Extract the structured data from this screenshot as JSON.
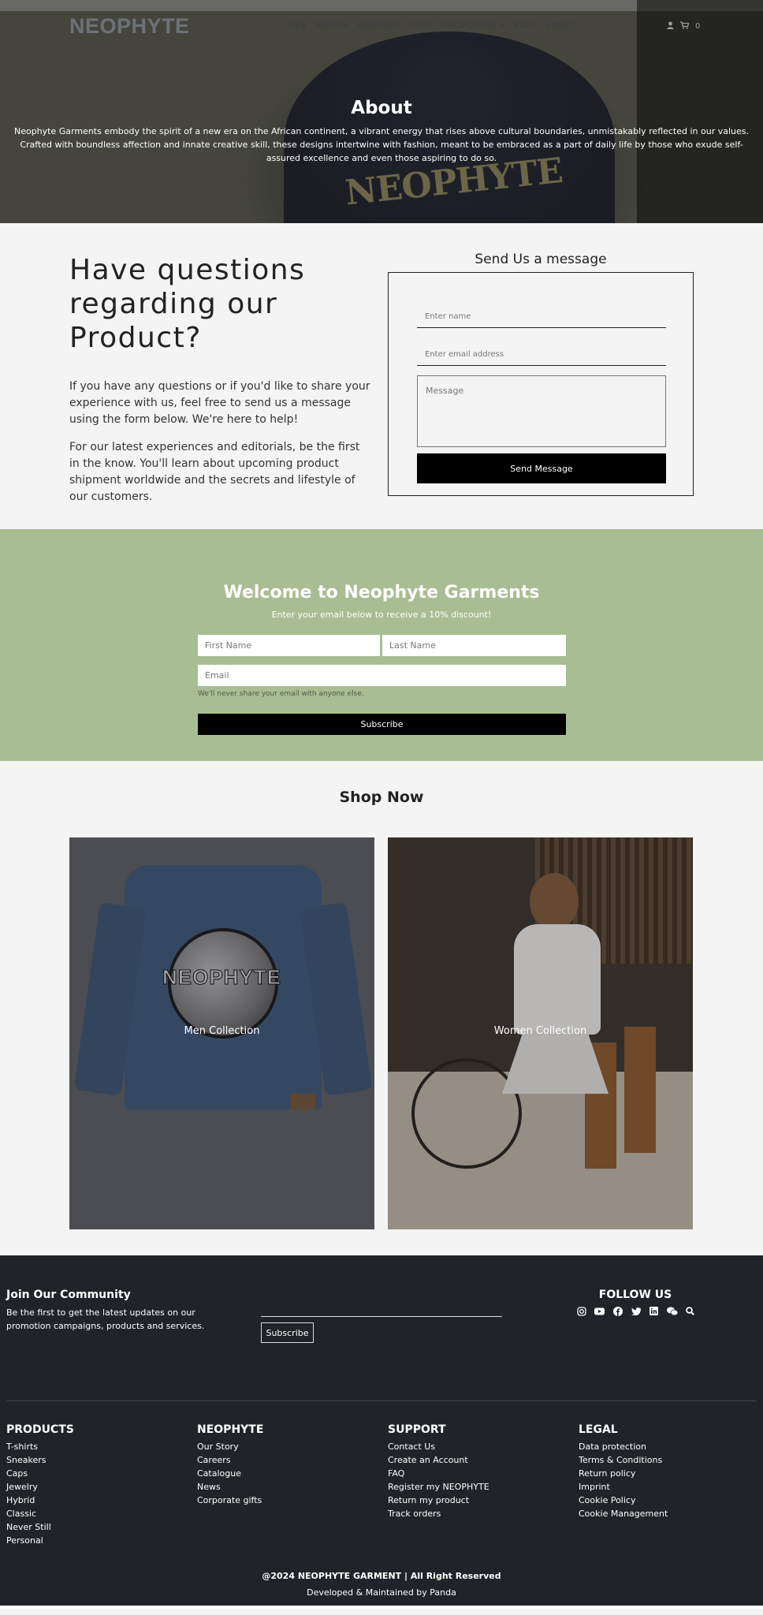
{
  "brand": "NEOPHYTE",
  "nav": {
    "links": [
      "MEN",
      "WOMEN",
      "SNEAKERS",
      "SHOP",
      "COLLECTIONS ▾",
      "BLOG",
      "ABOUT"
    ],
    "cart_count": "0"
  },
  "hero": {
    "title": "About",
    "text": "Neophyte Garments embody the spirit of a new era on the African continent, a vibrant energy that rises above cultural boundaries, unmistakably reflected in our values. Crafted with boundless affection and innate creative skill, these designs intertwine with fashion, meant to be embraced as a part of daily life by those who exude self-assured excellence and even those aspiring to do so."
  },
  "contact": {
    "heading": "Have questions regarding our Product?",
    "paragraph1": "If you have any questions or if you'd like to share your experience with us, feel free to send us a message using the form below. We're here to help!",
    "paragraph2": "For our latest experiences and editorials, be the first in the know. You'll learn about upcoming product shipment worldwide and the secrets and lifestyle of our customers.",
    "form_title": "Send Us a message",
    "name_placeholder": "Enter name",
    "email_placeholder": "Enter email address",
    "message_placeholder": "Message",
    "send_label": "Send Message"
  },
  "newsletter": {
    "title": "Welcome to Neophyte Garments",
    "subtitle": "Enter your email below to receive a 10% discount!",
    "first_name_placeholder": "First Name",
    "last_name_placeholder": "Last Name",
    "email_placeholder": "Email",
    "note": "We'll never share your email with anyone else.",
    "subscribe_label": "Subscribe"
  },
  "shop": {
    "title": "Shop Now",
    "collections": [
      {
        "label": "Men Collection",
        "print": "NEOPHYTE"
      },
      {
        "label": "Women Collection"
      }
    ]
  },
  "footer": {
    "join_title": "Join Our Community",
    "join_text": "Be the first to get the latest updates on our promotion campaigns, products and services.",
    "join_button": "Subscribe",
    "follow_title": "FOLLOW US",
    "social_icons": [
      "instagram-icon",
      "youtube-icon",
      "facebook-icon",
      "twitter-icon",
      "linkedin-icon",
      "wechat-icon",
      "search-icon"
    ],
    "columns": [
      {
        "title": "PRODUCTS",
        "links": [
          "T-shirts",
          "Sneakers",
          "Caps",
          "Jewelry",
          "Hybrid",
          "Classic",
          "Never Still",
          "Personal"
        ]
      },
      {
        "title": "NEOPHYTE",
        "links": [
          "Our Story",
          "Careers",
          "Catalogue",
          "News",
          "Corporate gifts"
        ]
      },
      {
        "title": "SUPPORT",
        "links": [
          "Contact Us",
          "Create an Account",
          "FAQ",
          "Register my NEOPHYTE",
          "Return my product",
          "Track orders"
        ]
      },
      {
        "title": "LEGAL",
        "links": [
          "Data protection",
          "Terms & Conditions",
          "Return policy",
          "Imprint",
          "Cookie Policy",
          "Cookie Management"
        ]
      }
    ],
    "copyright": "@2024 NEOPHYTE GARMENT | All Right Reserved",
    "developer": "Developed & Maintained by Panda"
  }
}
